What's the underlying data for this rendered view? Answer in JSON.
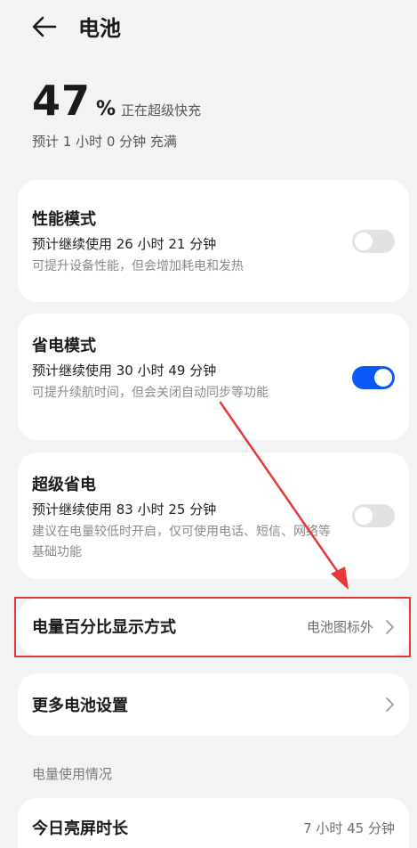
{
  "header": {
    "title": "电池"
  },
  "battery": {
    "percent": "47",
    "percent_sign": "%",
    "status": "正在超级快充",
    "eta": "预计 1 小时 0 分钟 充满"
  },
  "modes": [
    {
      "title": "性能模式",
      "subtitle": "预计继续使用 26 小时 21 分钟",
      "description": "可提升设备性能，但会增加耗电和发热",
      "enabled": false
    },
    {
      "title": "省电模式",
      "subtitle": "预计继续使用 30 小时 49 分钟",
      "description": "可提升续航时间，但会关闭自动同步等功能",
      "enabled": true
    },
    {
      "title": "超级省电",
      "subtitle": "预计继续使用 83 小时 25 分钟",
      "description": "建议在电量较低时开启，仅可使用电话、短信、网络等基础功能",
      "enabled": false
    }
  ],
  "percentage_display": {
    "title": "电量百分比显示方式",
    "value": "电池图标外"
  },
  "more_settings": {
    "title": "更多电池设置"
  },
  "usage": {
    "section_label": "电量使用情况",
    "screen_time_title": "今日亮屏时长",
    "screen_time_value": "7 小时 45 分钟"
  },
  "colors": {
    "accent": "#0a59f7",
    "annotation": "#e53935",
    "background": "#f1f3f5"
  }
}
